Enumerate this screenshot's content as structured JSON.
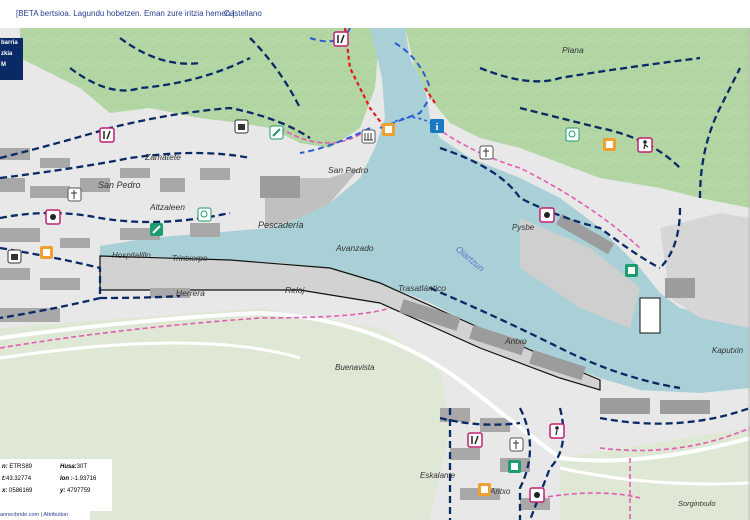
{
  "topbar": {
    "beta_link": "[BETA bertsioa. Lagundu hobetzen. Eman zure iritzia hemen.]",
    "language_link": "Castellano"
  },
  "logo": {
    "lines": [
      "barria",
      "zkia",
      "M"
    ]
  },
  "map": {
    "colors": {
      "water": "#a9d0d6",
      "forest": "#b3d6a4",
      "urban": "#e6e6e6",
      "park": "#c9dfb4",
      "trail_dark_blue": "#0a2a66",
      "trail_blue": "#2a5bd7",
      "trail_pink": "#e25cb3",
      "trail_red": "#e21b1b",
      "pier": "#b7b7b7"
    },
    "places": {
      "zamatete": "Zamatete",
      "san_pedro_district": "San Pedro",
      "altzaleen": "Altzaleen",
      "san_pedro_port": "San Pedro",
      "pescaderia": "Pescadería",
      "hospitalillo": "Hospitalillo",
      "trintxerpe": "Trintxerpe",
      "herrera": "Herrera",
      "reloj": "Reloj",
      "avanzado": "Avanzado",
      "trasatlantico": "Trasatlántico",
      "oiartzun": "Oiartzun",
      "pysbe": "Pysbe",
      "antxo": "Antxo",
      "kaputxinoak": "Kaputxin",
      "buenavista": "Buenavista",
      "eskalante": "Eskalante",
      "antxo_south": "Antxo",
      "sorgintxulo": "Sorgintxulo",
      "plana": "Plana"
    },
    "icons": [
      "restaurant-icon",
      "info-icon",
      "hostel-icon",
      "shop-icon",
      "hiking-icon",
      "museum-icon",
      "park-icon",
      "viewpoint-icon",
      "sport-icon",
      "church-icon"
    ]
  },
  "coords_panel": {
    "datum_key": "n:",
    "datum_val": "ETRS89",
    "zone_key": "Husa:",
    "zone_val": "30T",
    "lat_key": "t:",
    "lat_val": "43.32774",
    "lon_key": "lon :",
    "lon_val": "-1.93716",
    "x_key": "x:",
    "x_val": "0586169",
    "y_key": "y:",
    "y_val": "4797759"
  },
  "attribution": {
    "site": "annecbride.com",
    "separator": " | ",
    "link": "Attribution"
  }
}
